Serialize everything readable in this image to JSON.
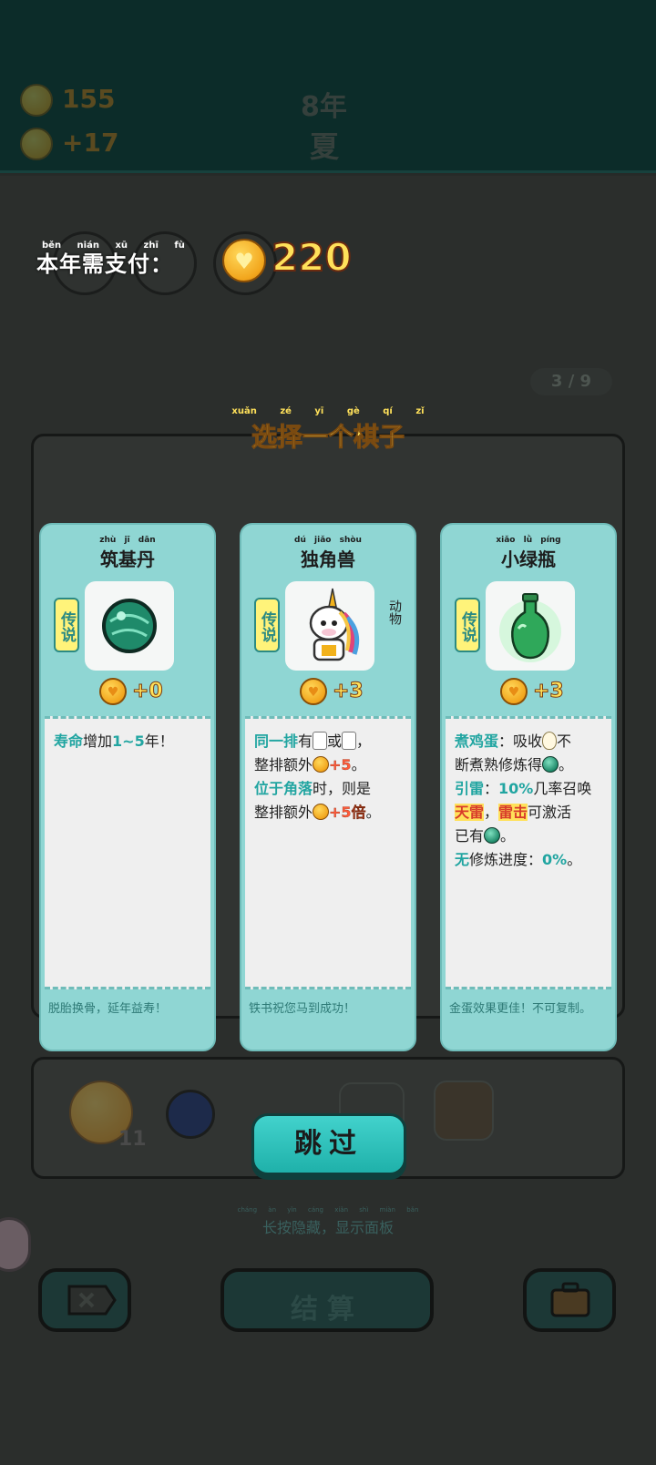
{
  "status": {
    "coins": "155",
    "income": "+17",
    "year": "8年",
    "season": "夏"
  },
  "payment": {
    "label": "本年需支付：",
    "label_pinyin": [
      "běn",
      "nián",
      "xū",
      "zhī",
      "fù"
    ],
    "amount": "220"
  },
  "progress": "3 / 9",
  "choose": {
    "title": "选择一个棋子",
    "pinyin": "xuǎn zé yī gè qí zǐ"
  },
  "cards": [
    {
      "name": "筑基丹",
      "name_pinyin": "zhù jī dān",
      "rarity": "传说",
      "icon": "green-orb-icon",
      "value": "+0",
      "desc": [
        [
          {
            "t": "寿命",
            "k": "kw"
          },
          {
            "t": "增加"
          },
          {
            "t": "1~5",
            "k": "kw"
          },
          {
            "t": "年！"
          }
        ]
      ],
      "flavor": "脱胎换骨，延年益寿！"
    },
    {
      "name": "独角兽",
      "name_pinyin": "dú jiǎo shòu",
      "rarity": "传说",
      "icon": "unicorn-icon",
      "side_note": "动物",
      "value": "+3",
      "desc": [
        [
          {
            "t": "同一排",
            "k": "kw"
          },
          {
            "t": "有"
          },
          {
            "i": "uni"
          },
          {
            "t": "或"
          },
          {
            "i": "uni"
          },
          {
            "t": "，"
          }
        ],
        [
          {
            "t": "整排额外"
          },
          {
            "i": "coin"
          },
          {
            "t": "+5",
            "k": "bonus"
          },
          {
            "t": "。"
          }
        ],
        [
          {
            "t": "位于角落",
            "k": "kw"
          },
          {
            "t": "时，则是"
          }
        ],
        [
          {
            "t": "整排额外"
          },
          {
            "i": "coin"
          },
          {
            "t": "+5倍",
            "k": "bonus"
          },
          {
            "t": "。"
          }
        ]
      ],
      "flavor": "铁书祝您马到成功！"
    },
    {
      "name": "小绿瓶",
      "name_pinyin": "xiǎo lǜ píng",
      "rarity": "传说",
      "icon": "green-bottle-icon",
      "value": "+3",
      "desc": [
        [
          {
            "t": "煮鸡蛋",
            "k": "kw"
          },
          {
            "t": "：吸收"
          },
          {
            "i": "egg"
          },
          {
            "t": "不"
          }
        ],
        [
          {
            "t": "断煮熟修炼得"
          },
          {
            "i": "orb"
          },
          {
            "t": "。"
          }
        ],
        [
          {
            "t": "引雷",
            "k": "kw"
          },
          {
            "t": "："
          },
          {
            "t": "10%",
            "k": "kw"
          },
          {
            "t": "几率召唤"
          }
        ],
        [
          {
            "t": "天雷",
            "k": "kw2"
          },
          {
            "t": "，"
          },
          {
            "t": "雷击",
            "k": "kw2"
          },
          {
            "t": "可激活"
          }
        ],
        [
          {
            "t": "已有"
          },
          {
            "i": "orb"
          },
          {
            "t": "。"
          }
        ],
        [
          {
            "t": "无",
            "k": "kw"
          },
          {
            "t": "修炼进度："
          },
          {
            "t": "0%",
            "k": "kw"
          },
          {
            "t": "。"
          }
        ]
      ],
      "flavor": "金蛋效果更佳！不可复制。"
    }
  ],
  "skip_label": "跳过",
  "hint": "长按隐藏，显示面板",
  "hint_pinyin": "cháng àn yǐn cáng xiǎn shì miàn bǎn",
  "settle_label": "结算",
  "inventory_count": "11",
  "colors": {
    "card_bg": "#8fd6d3",
    "accent_teal": "#21a5a1",
    "gold": "#ffe15a"
  }
}
